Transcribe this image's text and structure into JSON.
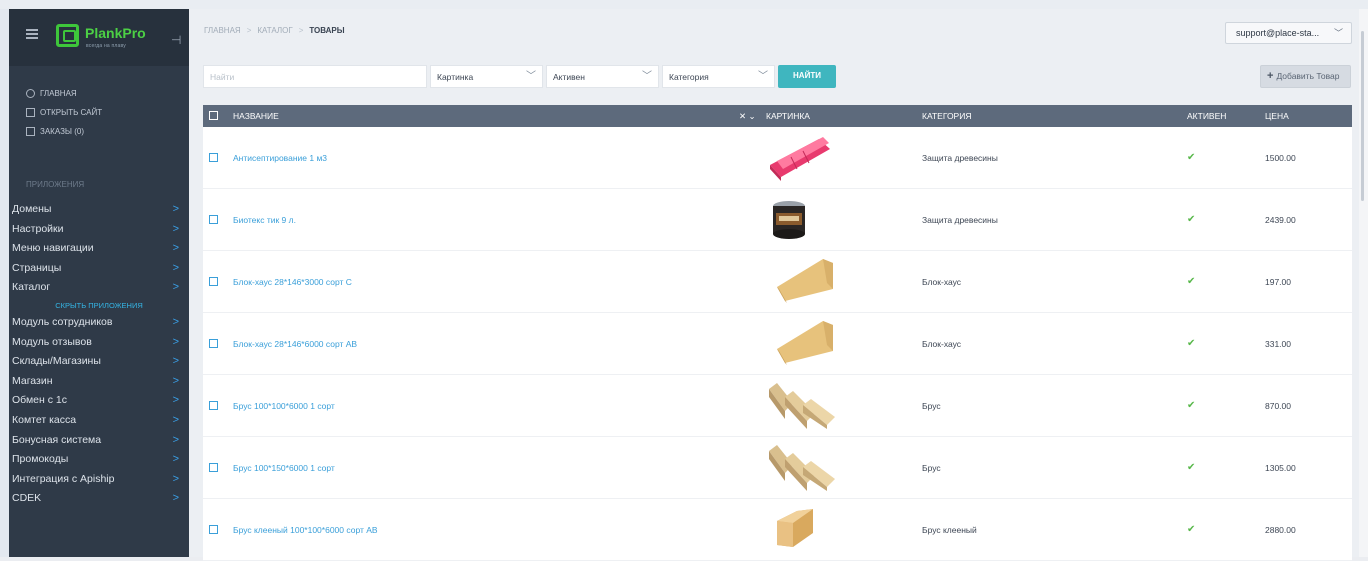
{
  "app": {
    "logo_name": "PlankPro",
    "logo_tagline": "всегда на плаву"
  },
  "sidebar": {
    "main_items": [
      {
        "label": "ГЛАВНАЯ",
        "icon": "circle-icon"
      },
      {
        "label": "ОТКРЫТЬ САЙТ",
        "icon": "window-icon"
      },
      {
        "label": "ЗАКАЗЫ (0)",
        "icon": "window-icon"
      }
    ],
    "section_title": "ПРИЛОЖЕНИЯ",
    "apps_top": [
      "Домены",
      "Настройки",
      "Меню навигации",
      "Страницы",
      "Каталог"
    ],
    "hide_apps_label": "СКРЫТЬ ПРИЛОЖЕНИЯ",
    "apps_bottom": [
      "Модуль сотрудников",
      "Модуль отзывов",
      "Склады/Магазины",
      "Магазин",
      "Обмен с 1с",
      "Комтет касса",
      "Бонусная система",
      "Промокоды",
      "Интеграция с Apiship",
      "CDEK"
    ]
  },
  "header": {
    "breadcrumb": [
      "ГЛАВНАЯ",
      "КАТАЛОГ",
      "ТОВАРЫ"
    ],
    "user": "support@place-sta..."
  },
  "filters": {
    "search_placeholder": "Найти",
    "picture_select": "Картинка",
    "active_select": "Активен",
    "category_select": "Категория",
    "find_button": "НАЙТИ",
    "add_button": "Добавить Товар"
  },
  "table": {
    "columns": {
      "name": "НАЗВАНИЕ",
      "picture": "КАРТИНКА",
      "category": "КАТЕГОРИЯ",
      "active": "АКТИВЕН",
      "price": "ЦЕНА"
    },
    "sort_marker": "✕ ⌄",
    "active_mark": "✔",
    "rows": [
      {
        "name": "Антисептирование 1 м3",
        "category": "Защита древесины",
        "price": "1500.00",
        "image": "pink-boards-image"
      },
      {
        "name": "Биотекс тик 9 л.",
        "category": "Защита древесины",
        "price": "2439.00",
        "image": "paint-can-image"
      },
      {
        "name": "Блок-хаус 28*146*3000 сорт С",
        "category": "Блок-хаус",
        "price": "197.00",
        "image": "blockhouse-board-image"
      },
      {
        "name": "Блок-хаус 28*146*6000 сорт АВ",
        "category": "Блок-хаус",
        "price": "331.00",
        "image": "blockhouse-board-image"
      },
      {
        "name": "Брус 100*100*6000 1 сорт",
        "category": "Брус",
        "price": "870.00",
        "image": "timber-beams-image"
      },
      {
        "name": "Брус 100*150*6000 1 сорт",
        "category": "Брус",
        "price": "1305.00",
        "image": "timber-beams-image"
      },
      {
        "name": "Брус клееный 100*100*6000 сорт АВ",
        "category": "Брус клееный",
        "price": "2880.00",
        "image": "glued-beam-image"
      }
    ]
  },
  "colors": {
    "sidebar_bg": "#2f3a48",
    "header_row": "#5d6a7c",
    "accent": "#3fb6bf",
    "link": "#3a9fd9",
    "check": "#58b84a",
    "logo_green": "#3ec63b"
  }
}
